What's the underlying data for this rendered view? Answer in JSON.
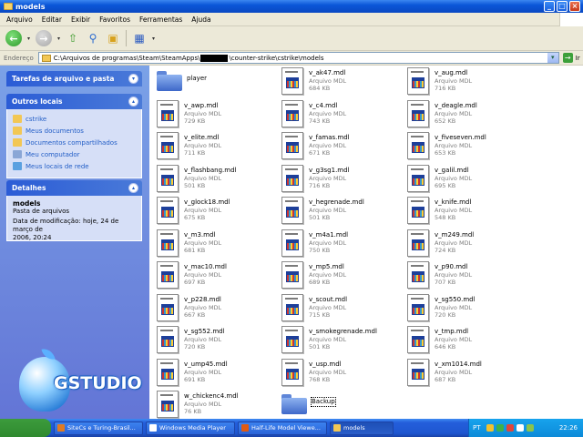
{
  "window": {
    "title": "models"
  },
  "menu": [
    "Arquivo",
    "Editar",
    "Exibir",
    "Favoritos",
    "Ferramentas",
    "Ajuda"
  ],
  "address": {
    "label": "Endereço",
    "path_start": "C:\\Arquivos de programas\\Steam\\SteamApps\\",
    "path_end": "\\counter-strike\\cstrike\\models",
    "go_label": "Ir"
  },
  "sidebar": {
    "tasks_header": "Tarefas de arquivo e pasta",
    "places_header": "Outros locais",
    "places": [
      {
        "label": "cstrike",
        "icon": "folder-icon",
        "color": "#f2c755"
      },
      {
        "label": "Meus documentos",
        "icon": "my-documents-icon",
        "color": "#f2c755"
      },
      {
        "label": "Documentos compartilhados",
        "icon": "shared-documents-icon",
        "color": "#f2c755"
      },
      {
        "label": "Meu computador",
        "icon": "my-computer-icon",
        "color": "#8aa6d6"
      },
      {
        "label": "Meus locais de rede",
        "icon": "network-places-icon",
        "color": "#5aa0e0"
      }
    ],
    "details_header": "Detalhes",
    "details": {
      "name": "models",
      "type": "Pasta de arquivos",
      "modified_1": "Data de modificação: hoje, 24 de março de",
      "modified_2": "2006, 20:24"
    },
    "logo_text": "GSTUDIO"
  },
  "files": [
    {
      "name": "player",
      "kind": "folder"
    },
    {
      "name": "v_ak47.mdl",
      "type": "Arquivo MDL",
      "size": "684 KB",
      "kind": "file"
    },
    {
      "name": "v_aug.mdl",
      "type": "Arquivo MDL",
      "size": "716 KB",
      "kind": "file"
    },
    {
      "name": "v_awp.mdl",
      "type": "Arquivo MDL",
      "size": "729 KB",
      "kind": "file"
    },
    {
      "name": "v_c4.mdl",
      "type": "Arquivo MDL",
      "size": "743 KB",
      "kind": "file"
    },
    {
      "name": "v_deagle.mdl",
      "type": "Arquivo MDL",
      "size": "652 KB",
      "kind": "file"
    },
    {
      "name": "v_elite.mdl",
      "type": "Arquivo MDL",
      "size": "711 KB",
      "kind": "file"
    },
    {
      "name": "v_famas.mdl",
      "type": "Arquivo MDL",
      "size": "671 KB",
      "kind": "file"
    },
    {
      "name": "v_fiveseven.mdl",
      "type": "Arquivo MDL",
      "size": "653 KB",
      "kind": "file"
    },
    {
      "name": "v_flashbang.mdl",
      "type": "Arquivo MDL",
      "size": "501 KB",
      "kind": "file"
    },
    {
      "name": "v_g3sg1.mdl",
      "type": "Arquivo MDL",
      "size": "716 KB",
      "kind": "file"
    },
    {
      "name": "v_galil.mdl",
      "type": "Arquivo MDL",
      "size": "695 KB",
      "kind": "file"
    },
    {
      "name": "v_glock18.mdl",
      "type": "Arquivo MDL",
      "size": "675 KB",
      "kind": "file"
    },
    {
      "name": "v_hegrenade.mdl",
      "type": "Arquivo MDL",
      "size": "501 KB",
      "kind": "file"
    },
    {
      "name": "v_knife.mdl",
      "type": "Arquivo MDL",
      "size": "548 KB",
      "kind": "file"
    },
    {
      "name": "v_m3.mdl",
      "type": "Arquivo MDL",
      "size": "681 KB",
      "kind": "file"
    },
    {
      "name": "v_m4a1.mdl",
      "type": "Arquivo MDL",
      "size": "750 KB",
      "kind": "file"
    },
    {
      "name": "v_m249.mdl",
      "type": "Arquivo MDL",
      "size": "724 KB",
      "kind": "file"
    },
    {
      "name": "v_mac10.mdl",
      "type": "Arquivo MDL",
      "size": "697 KB",
      "kind": "file"
    },
    {
      "name": "v_mp5.mdl",
      "type": "Arquivo MDL",
      "size": "689 KB",
      "kind": "file"
    },
    {
      "name": "v_p90.mdl",
      "type": "Arquivo MDL",
      "size": "707 KB",
      "kind": "file"
    },
    {
      "name": "v_p228.mdl",
      "type": "Arquivo MDL",
      "size": "667 KB",
      "kind": "file"
    },
    {
      "name": "v_scout.mdl",
      "type": "Arquivo MDL",
      "size": "715 KB",
      "kind": "file"
    },
    {
      "name": "v_sg550.mdl",
      "type": "Arquivo MDL",
      "size": "720 KB",
      "kind": "file"
    },
    {
      "name": "v_sg552.mdl",
      "type": "Arquivo MDL",
      "size": "720 KB",
      "kind": "file"
    },
    {
      "name": "v_smokegrenade.mdl",
      "type": "Arquivo MDL",
      "size": "501 KB",
      "kind": "file"
    },
    {
      "name": "v_tmp.mdl",
      "type": "Arquivo MDL",
      "size": "646 KB",
      "kind": "file"
    },
    {
      "name": "v_ump45.mdl",
      "type": "Arquivo MDL",
      "size": "691 KB",
      "kind": "file"
    },
    {
      "name": "v_usp.mdl",
      "type": "Arquivo MDL",
      "size": "768 KB",
      "kind": "file"
    },
    {
      "name": "v_xm1014.mdl",
      "type": "Arquivo MDL",
      "size": "687 KB",
      "kind": "file"
    },
    {
      "name": "w_chickenc4.mdl",
      "type": "Arquivo MDL",
      "size": "76 KB",
      "kind": "file"
    },
    {
      "name": "Backup",
      "kind": "folder",
      "selected": true
    }
  ],
  "taskbar": {
    "items": [
      {
        "label": "SiteCs e Turing-Brasil...",
        "color": "#e07b22"
      },
      {
        "label": "Windows Media Player",
        "color": "#ffffff"
      },
      {
        "label": "Half-Life Model Viewe...",
        "color": "#e05a12"
      },
      {
        "label": "models",
        "color": "#f2c755",
        "active": true
      }
    ],
    "lang": "PT",
    "clock": "22:26"
  }
}
